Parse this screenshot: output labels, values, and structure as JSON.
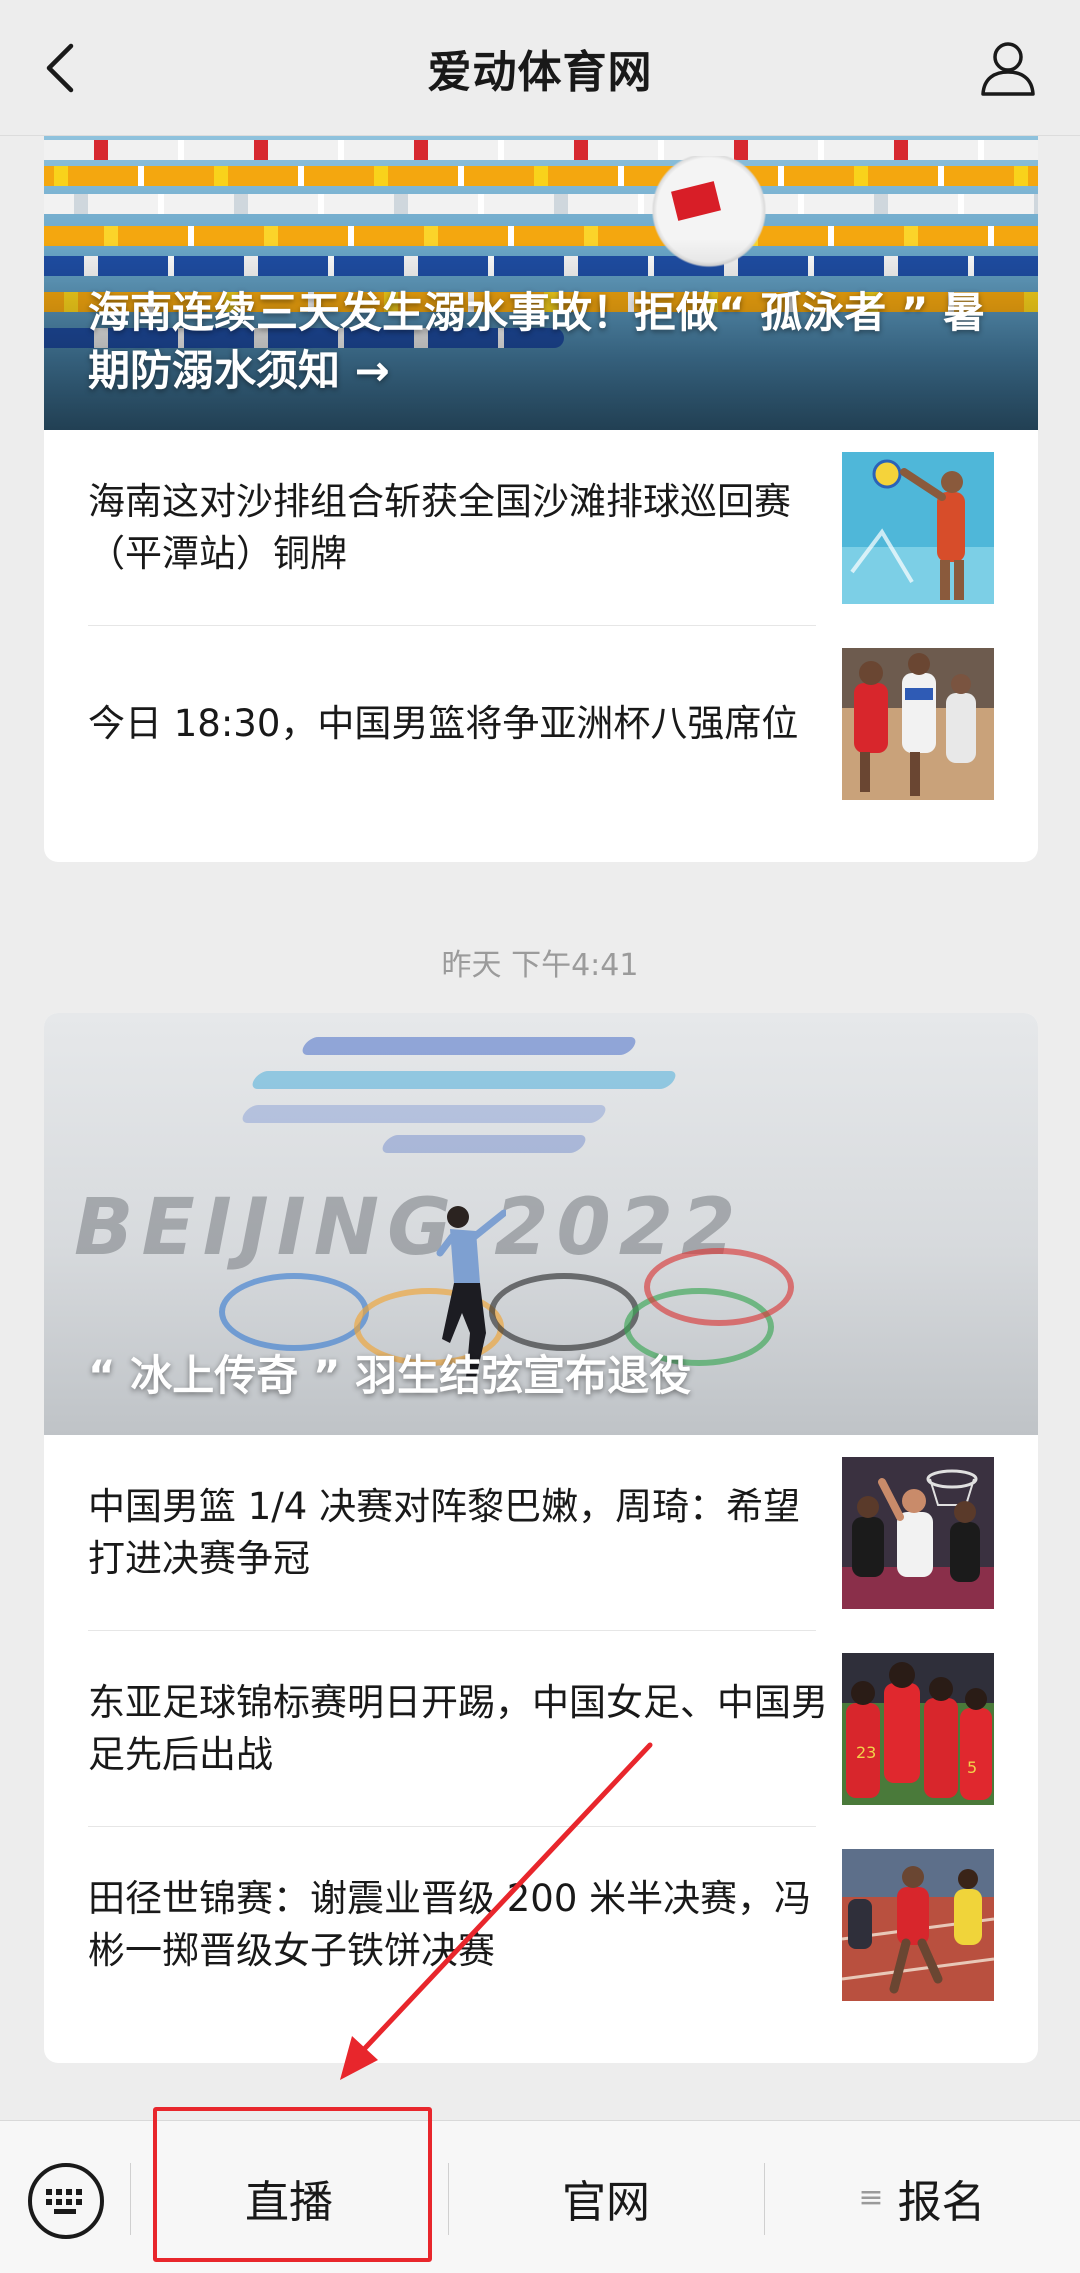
{
  "header": {
    "title": "爱动体育网",
    "back_icon": "chevron-left-icon",
    "profile_icon": "person-icon"
  },
  "feed": {
    "group1": {
      "hero": {
        "title": "海南连续三天发生溺水事故！拒做“ 孤泳者 ” 暑期防溺水须知 →",
        "image": "swimmer-pool-image"
      },
      "items": [
        {
          "title": "海南这对沙排组合斩获全国沙滩排球巡回赛（平潭站）铜牌",
          "thumb": "beach-volleyball-image"
        },
        {
          "title": "今日 18:30，中国男篮将争亚洲杯八强席位",
          "thumb": "basketball-image"
        }
      ]
    },
    "timestamp": "昨天 下午4:41",
    "group2": {
      "hero": {
        "title": "“ 冰上传奇 ” 羽生结弦宣布退役",
        "image": "figure-skating-image",
        "background_text": "BEIJING 2022"
      },
      "items": [
        {
          "title": "中国男篮 1/4 决赛对阵黎巴嫩，周琦：希望打进决赛争冠",
          "thumb": "basketball-game-image"
        },
        {
          "title": "东亚足球锦标赛明日开踢，中国女足、中国男足先后出战",
          "thumb": "football-team-image"
        },
        {
          "title": "田径世锦赛：谢震业晋级 200 米半决赛，冯彬一掷晋级女子铁饼决赛",
          "thumb": "sprinter-image"
        }
      ]
    }
  },
  "bottom_bar": {
    "keyboard_icon": "keyboard-icon",
    "tabs": [
      {
        "label": "直播"
      },
      {
        "label": "官网"
      },
      {
        "label": "报名",
        "icon": "menu-lines-icon",
        "glyph": "≡"
      }
    ]
  },
  "annotation": {
    "highlight_color": "#e8262c"
  }
}
